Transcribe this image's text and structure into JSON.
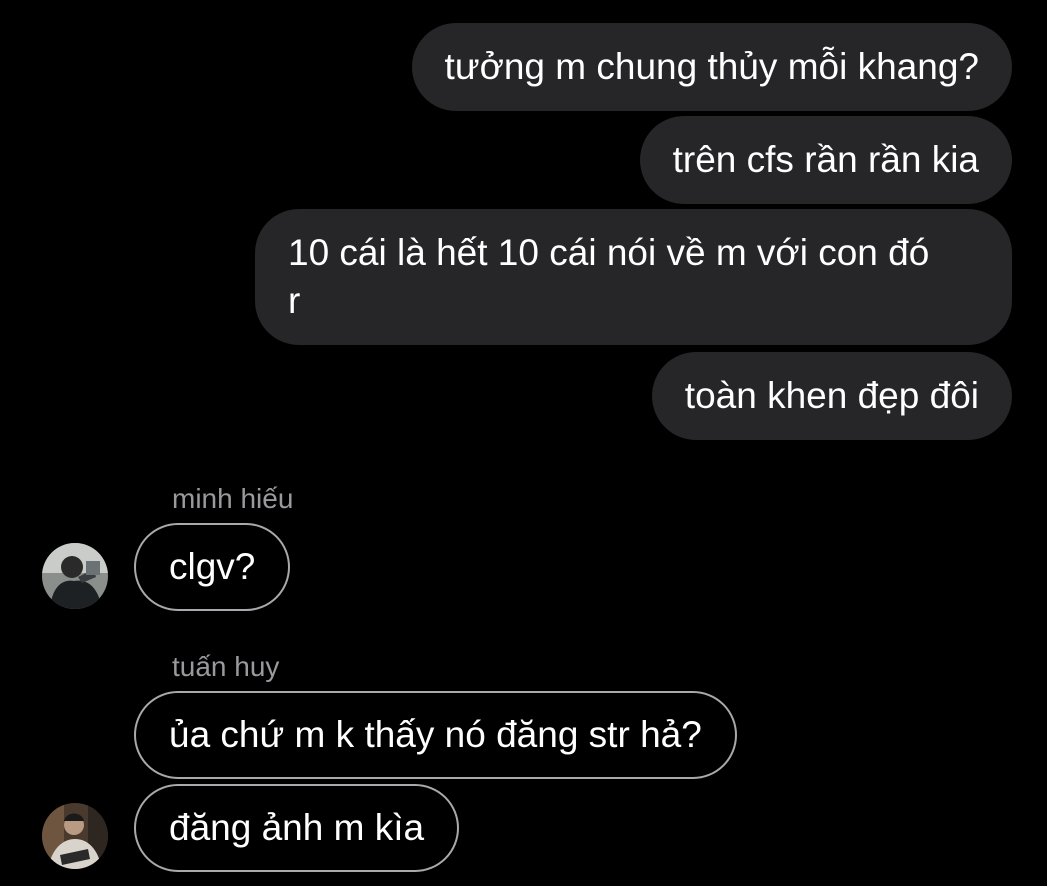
{
  "outgoing": [
    {
      "text": "tưởng m chung thủy mỗi khang?"
    },
    {
      "text": "trên cfs rần rần kia"
    },
    {
      "text": "10 cái là hết 10 cái nói về m với con đó\nr"
    },
    {
      "text": "toàn khen đẹp đôi"
    }
  ],
  "groups": [
    {
      "sender": "minh hiếu",
      "avatar_icon": "user-avatar-photo",
      "messages": [
        {
          "text": "clgv?"
        }
      ]
    },
    {
      "sender": "tuấn huy",
      "avatar_icon": "user-avatar-photo",
      "messages": [
        {
          "text": "ủa chứ m k thấy nó đăng str hả?"
        },
        {
          "text": "đăng ảnh m kìa"
        }
      ]
    }
  ],
  "colors": {
    "background": "#000000",
    "outgoing_bubble": "#262628",
    "incoming_border": "#a9a9ad",
    "sender_name": "#9a9a9e",
    "text": "#ffffff"
  }
}
